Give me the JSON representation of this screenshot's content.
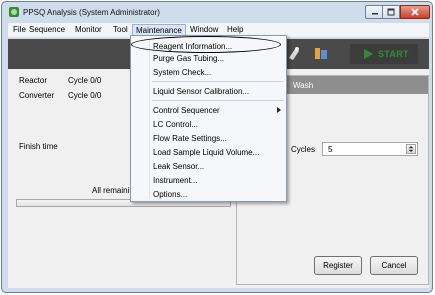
{
  "window": {
    "title": "PPSQ Analysis (System Administrator)"
  },
  "menubar": {
    "items": [
      "File",
      "Sequence",
      "Monitor",
      "Tool",
      "Maintenance",
      "Window",
      "Help"
    ]
  },
  "toolbar": {
    "start_label": "START"
  },
  "main": {
    "reactor_label": "Reactor",
    "reactor_value": "Cycle 0/0",
    "converter_label": "Converter",
    "converter_value": "Cycle 0/0",
    "finish_label": "Finish time",
    "remaining_label": "All remainin"
  },
  "right_panel": {
    "title": "Wash",
    "cycles_label": "Cycles",
    "cycles_value": "5",
    "register_label": "Register",
    "cancel_label": "Cancel"
  },
  "maintenance_menu": {
    "items": [
      "Reagent Information...",
      "Purge Gas Tubing...",
      "System Check...",
      "Liquid Sensor Calibration...",
      "Control Sequencer",
      "LC Control...",
      "Flow Rate Settings...",
      "Load Sample Liquid Volume...",
      "Leak Sensor...",
      "Instrument...",
      "Options..."
    ]
  },
  "colors": {
    "toolbar_bg": "#4a4a4a",
    "panel_header": "#8e8e8e",
    "start_text": "#2f8f2f",
    "close_button": "#c8412a"
  },
  "icons": [
    "app-icon",
    "minimize-icon",
    "maximize-icon",
    "close-icon",
    "gas-icon",
    "column-icon",
    "play-icon",
    "submenu-arrow-icon"
  ]
}
